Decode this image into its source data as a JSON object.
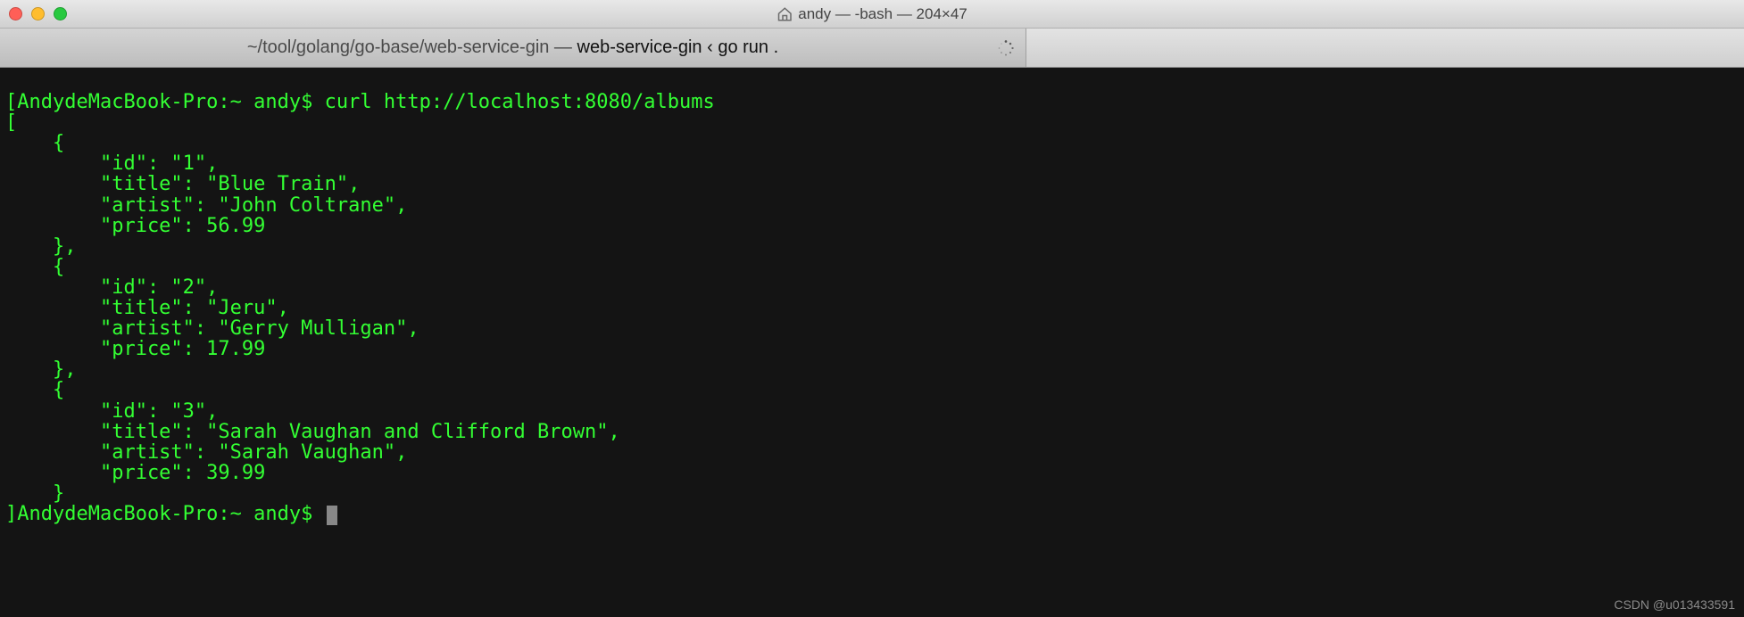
{
  "titlebar": {
    "title": "andy — -bash — 204×47"
  },
  "tab": {
    "path_prefix": "~/tool/golang/go-base/web-service-gin — ",
    "bold_part": "web-service-gin ‹ go run ."
  },
  "terminal": {
    "prompt1_prefix": "[",
    "prompt1_host": "AndydeMacBook-Pro:~ andy$ ",
    "command": "curl http://localhost:8080/albums",
    "json_open": "[",
    "obj_open": "    {",
    "albums": [
      {
        "id_line": "        \"id\": \"1\",",
        "title_line": "        \"title\": \"Blue Train\",",
        "artist_line": "        \"artist\": \"John Coltrane\",",
        "price_line": "        \"price\": 56.99"
      },
      {
        "id_line": "        \"id\": \"2\",",
        "title_line": "        \"title\": \"Jeru\",",
        "artist_line": "        \"artist\": \"Gerry Mulligan\",",
        "price_line": "        \"price\": 17.99"
      },
      {
        "id_line": "        \"id\": \"3\",",
        "title_line": "        \"title\": \"Sarah Vaughan and Clifford Brown\",",
        "artist_line": "        \"artist\": \"Sarah Vaughan\",",
        "price_line": "        \"price\": 39.99"
      }
    ],
    "obj_close_comma": "    },",
    "obj_close": "    }",
    "json_close_prefix": "]",
    "prompt2_host": "AndydeMacBook-Pro:~ andy$"
  },
  "watermark": "CSDN @u013433591"
}
